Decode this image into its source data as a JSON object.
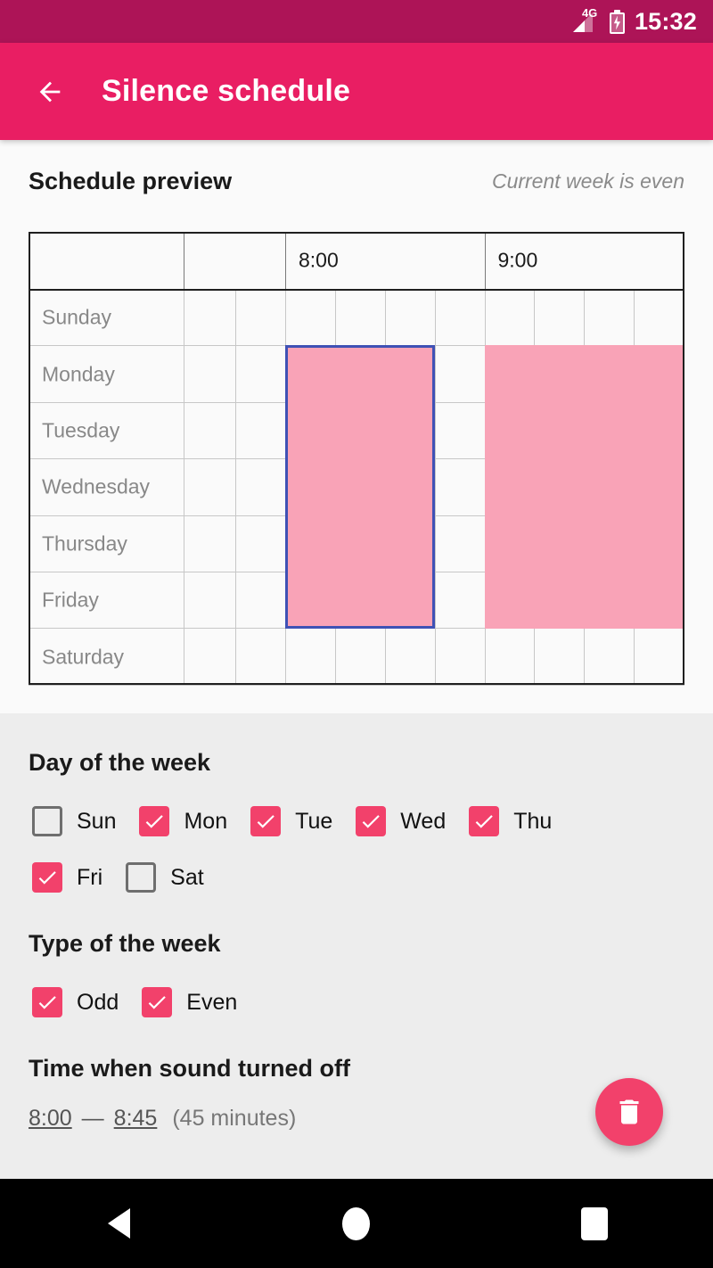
{
  "statusbar": {
    "network": "4G",
    "time": "15:32",
    "battery_state": "charging"
  },
  "appbar": {
    "back_icon": "arrow-left-icon",
    "title": "Silence schedule"
  },
  "preview": {
    "title": "Schedule preview",
    "note": "Current week is even",
    "hour_labels": [
      "8:00",
      "9:00"
    ],
    "days": [
      "Sunday",
      "Monday",
      "Tuesday",
      "Wednesday",
      "Thursday",
      "Friday",
      "Saturday"
    ],
    "highlight_color": "#F9A3B7",
    "selection_border_color": "#3F51B5",
    "blocks": [
      {
        "name": "selected-block",
        "days": [
          "Monday",
          "Tuesday",
          "Wednesday",
          "Thursday",
          "Friday"
        ],
        "start": "8:00",
        "end": "8:45",
        "selected": true
      },
      {
        "name": "second-block",
        "days": [
          "Monday",
          "Tuesday",
          "Wednesday",
          "Thursday",
          "Friday"
        ],
        "start": "9:00",
        "end": "10:00",
        "selected": false
      }
    ]
  },
  "settings": {
    "day_of_week": {
      "title": "Day of the week",
      "items": [
        {
          "label": "Sun",
          "checked": false
        },
        {
          "label": "Mon",
          "checked": true
        },
        {
          "label": "Tue",
          "checked": true
        },
        {
          "label": "Wed",
          "checked": true
        },
        {
          "label": "Thu",
          "checked": true
        },
        {
          "label": "Fri",
          "checked": true
        },
        {
          "label": "Sat",
          "checked": false
        }
      ]
    },
    "type_of_week": {
      "title": "Type of the week",
      "items": [
        {
          "label": "Odd",
          "checked": true
        },
        {
          "label": "Even",
          "checked": true
        }
      ]
    },
    "time_section": {
      "title": "Time when sound turned off",
      "start": "8:00",
      "dash": "—",
      "end": "8:45",
      "duration": "(45 minutes)"
    },
    "accent_color": "#F2416B",
    "delete_fab_icon": "trash-icon"
  },
  "navbar": {
    "back_icon": "triangle-back-icon",
    "home_icon": "circle-home-icon",
    "recents_icon": "square-recents-icon"
  }
}
